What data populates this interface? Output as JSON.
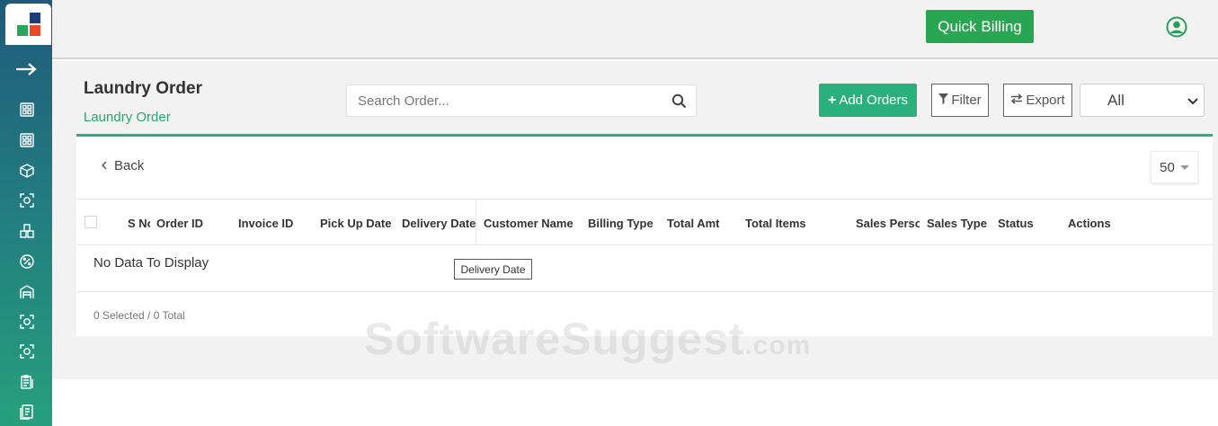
{
  "header": {
    "quick_billing_label": "Quick Billing",
    "user_icon": "user-circle-icon"
  },
  "sidebar": {
    "logo": "brand-logo",
    "toggle_icon": "arrow-right-icon",
    "items": [
      {
        "icon": "dashboard-icon"
      },
      {
        "icon": "dashboard-icon"
      },
      {
        "icon": "box-icon"
      },
      {
        "icon": "scan-icon"
      },
      {
        "icon": "inventory-icon"
      },
      {
        "icon": "percent-badge-icon"
      },
      {
        "icon": "warehouse-icon"
      },
      {
        "icon": "scan-icon"
      },
      {
        "icon": "scan-icon"
      },
      {
        "icon": "clipboard-icon"
      },
      {
        "icon": "document-icon"
      }
    ]
  },
  "page": {
    "title": "Laundry Order",
    "breadcrumb": "Laundry Order"
  },
  "toolbar": {
    "search_placeholder": "Search Order...",
    "add_orders_label": "Add Orders",
    "filter_label": "Filter",
    "export_label": "Export",
    "status_select_value": "All"
  },
  "card": {
    "back_label": "Back",
    "per_page_value": "50"
  },
  "table": {
    "columns": [
      "S No",
      "Order ID",
      "Invoice ID",
      "Pick Up Date",
      "Delivery Date",
      "Customer Name",
      "Billing Type",
      "Total Amt",
      "Total Items",
      "Sales Person",
      "Sales Type",
      "Status",
      "Actions"
    ],
    "empty_message": "No Data To Display",
    "tooltip": "Delivery Date",
    "footer_summary": "0 Selected / 0 Total"
  },
  "watermark": {
    "main": "SoftwareSuggest",
    "suffix": ".com"
  },
  "colors": {
    "accent_green": "#28a652",
    "add_button": "#2ab07a",
    "sidebar_top": "#1f5a7a",
    "sidebar_bottom": "#26a07c"
  }
}
